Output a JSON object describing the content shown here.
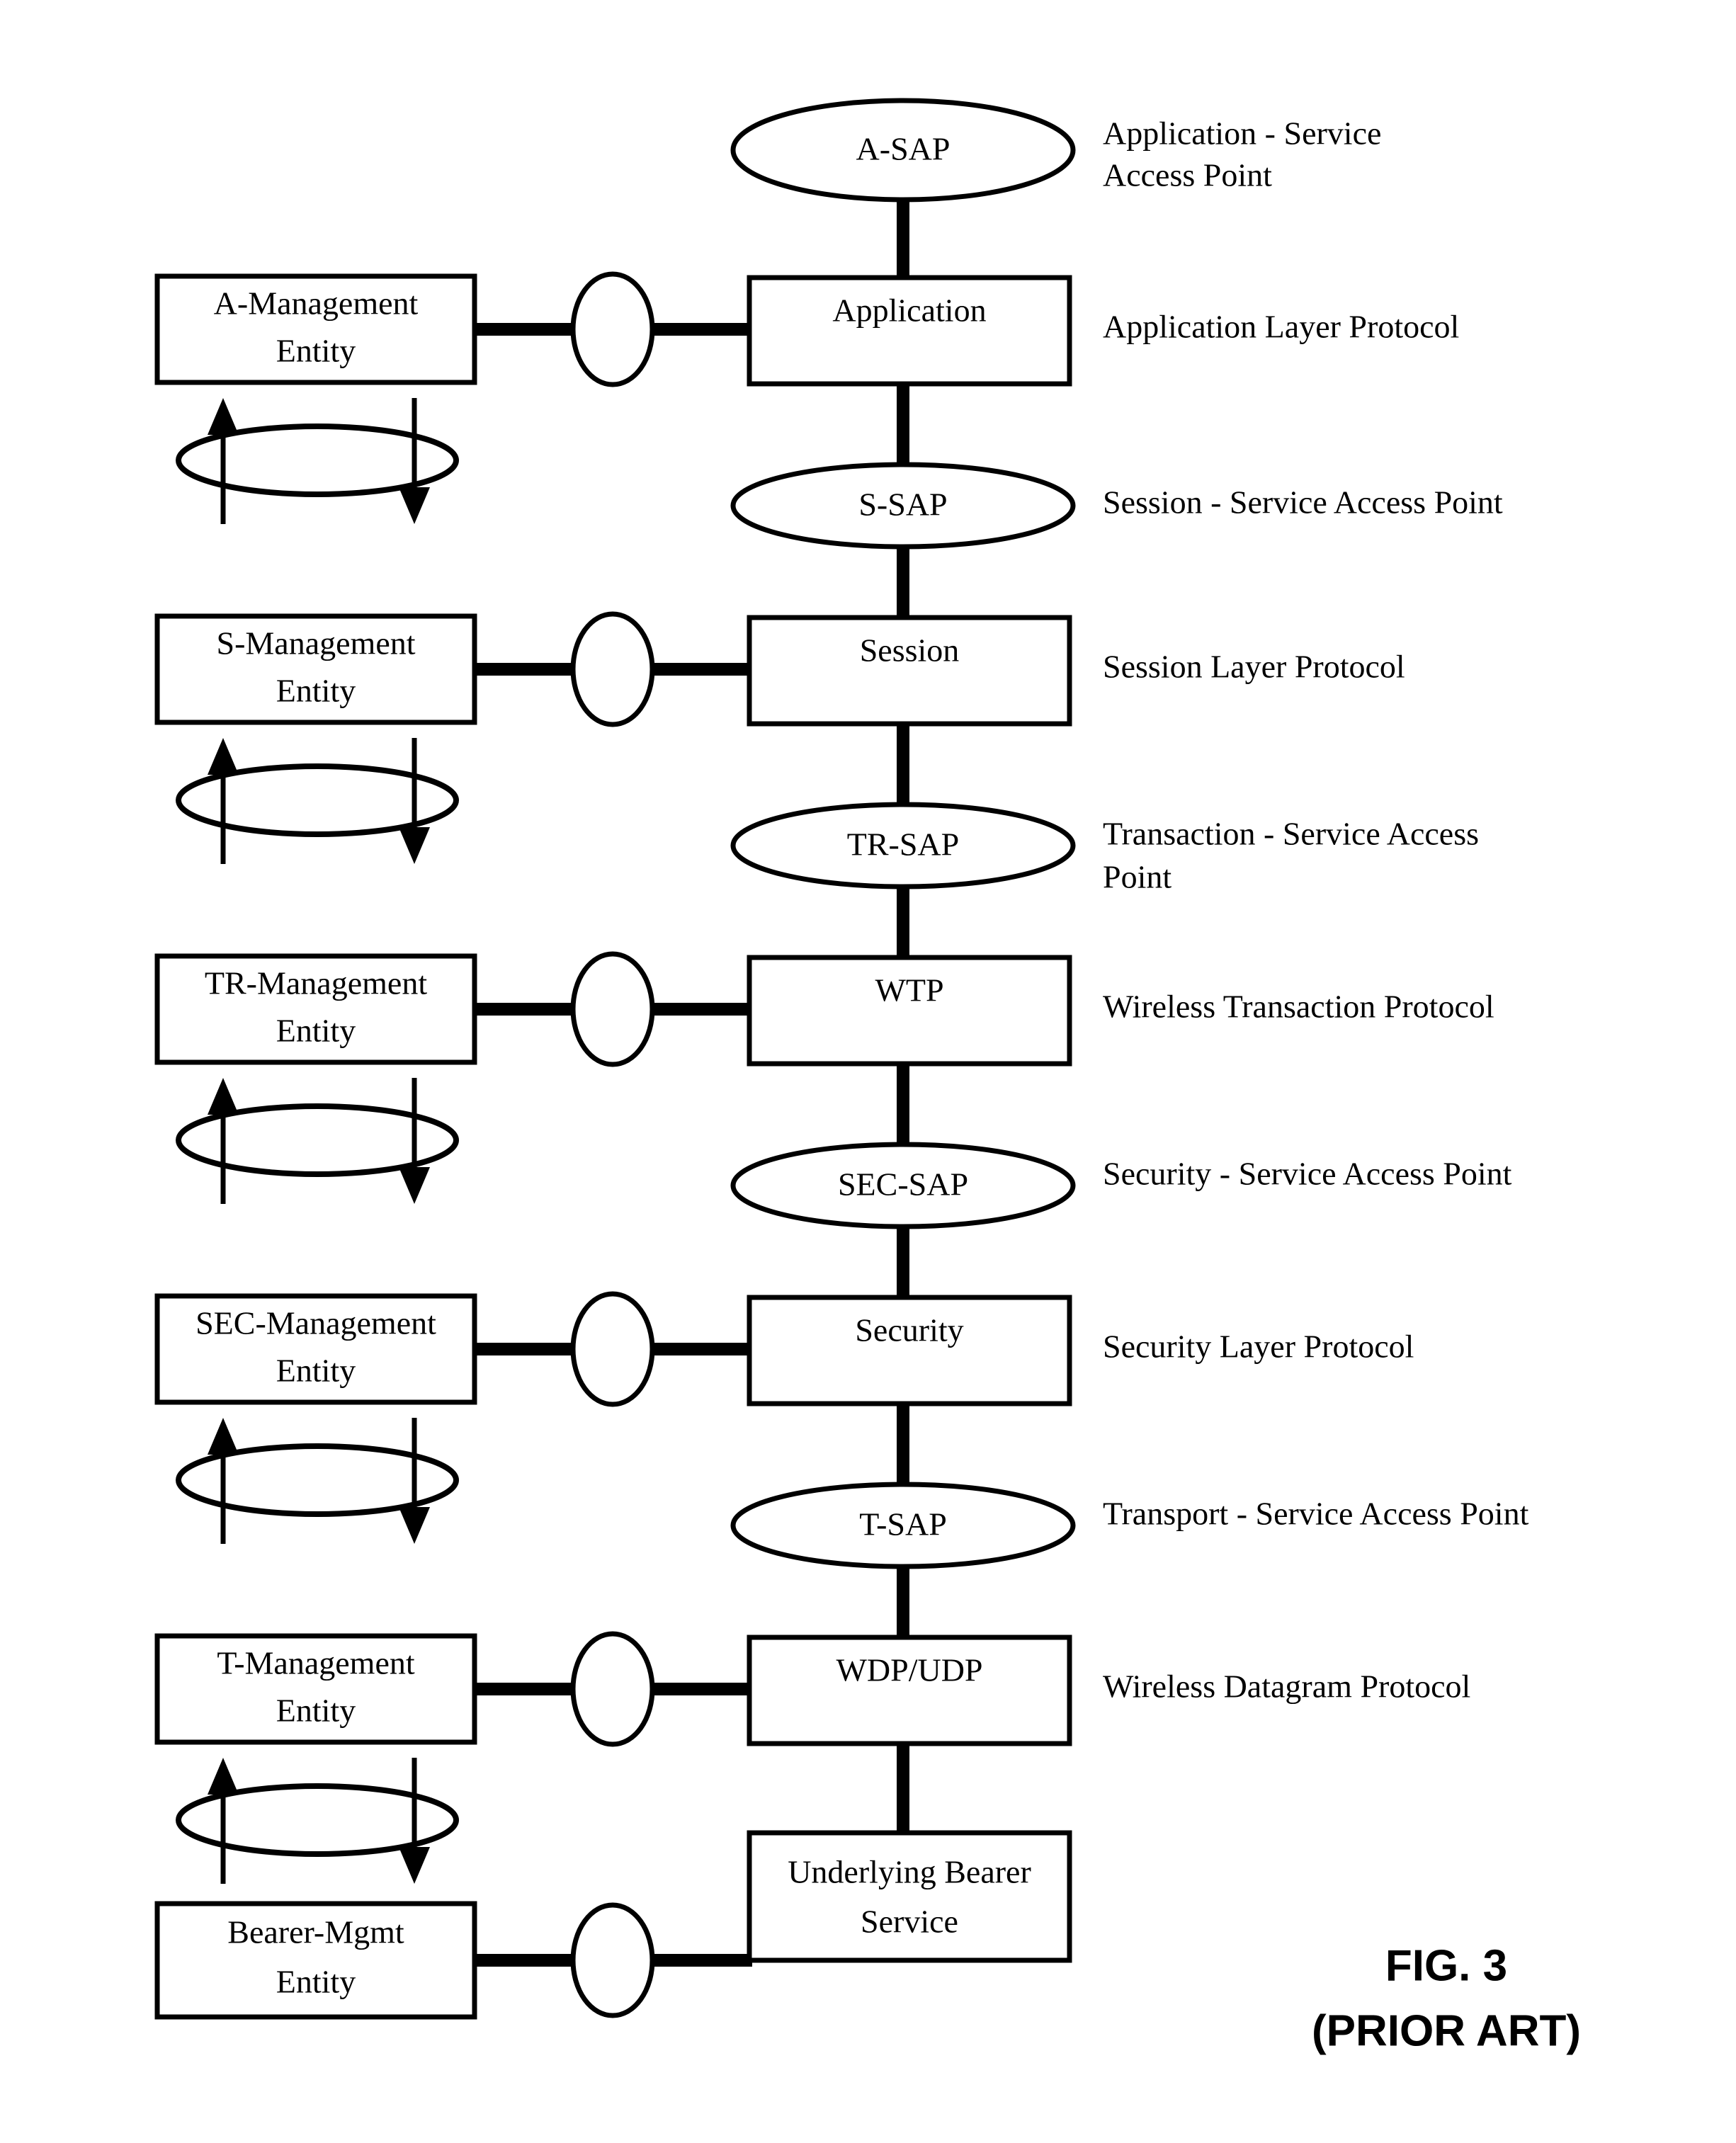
{
  "figure": {
    "caption_line1": "FIG. 3",
    "caption_line2": "(PRIOR ART)"
  },
  "sap_nodes": [
    {
      "id": "a-sap",
      "label": "A-SAP",
      "description": "Application - Service Access Point"
    },
    {
      "id": "s-sap",
      "label": "S-SAP",
      "description": "Session - Service Access Point"
    },
    {
      "id": "tr-sap",
      "label": "TR-SAP",
      "description": "Transaction - Service Access Point"
    },
    {
      "id": "sec-sap",
      "label": "SEC-SAP",
      "description": "Security - Service Access Point"
    },
    {
      "id": "t-sap",
      "label": "T-SAP",
      "description": "Transport - Service Access Point"
    }
  ],
  "layer_boxes": [
    {
      "id": "application",
      "label": "Application",
      "protocol": "Application Layer Protocol"
    },
    {
      "id": "session",
      "label": "Session",
      "protocol": "Session Layer Protocol"
    },
    {
      "id": "wtp",
      "label": "WTP",
      "protocol": "Wireless Transaction Protocol"
    },
    {
      "id": "security",
      "label": "Security",
      "protocol": "Security Layer Protocol"
    },
    {
      "id": "wdp-udp",
      "label": "WDP/UDP",
      "protocol": "Wireless Datagram Protocol"
    },
    {
      "id": "bearer",
      "label_line1": "Underlying Bearer",
      "label_line2": "Service",
      "protocol": ""
    }
  ],
  "management_entities": [
    {
      "id": "a-mgmt",
      "line1": "A-Management",
      "line2": "Entity"
    },
    {
      "id": "s-mgmt",
      "line1": "S-Management",
      "line2": "Entity"
    },
    {
      "id": "tr-mgmt",
      "line1": "TR-Management",
      "line2": "Entity"
    },
    {
      "id": "sec-mgmt",
      "line1": "SEC-Management",
      "line2": "Entity"
    },
    {
      "id": "t-mgmt",
      "line1": "T-Management",
      "line2": "Entity"
    },
    {
      "id": "bearer-mgmt",
      "line1": "Bearer-Mgmt",
      "line2": "Entity"
    }
  ],
  "right_labels": {
    "application_sap_line1": "Application - Service",
    "application_sap_line2": "Access Point",
    "application_protocol": "Application Layer Protocol",
    "session_sap": "Session - Service Access Point",
    "session_protocol": "Session Layer Protocol",
    "transaction_sap_line1": "Transaction - Service Access",
    "transaction_sap_line2": "Point",
    "transaction_protocol": "Wireless Transaction Protocol",
    "security_sap": "Security - Service Access Point",
    "security_protocol": "Security Layer Protocol",
    "transport_sap": "Transport - Service Access Point",
    "transport_protocol": "Wireless Datagram Protocol"
  },
  "colors": {
    "stroke": "#000000",
    "fill": "#ffffff",
    "background": "#ffffff"
  }
}
